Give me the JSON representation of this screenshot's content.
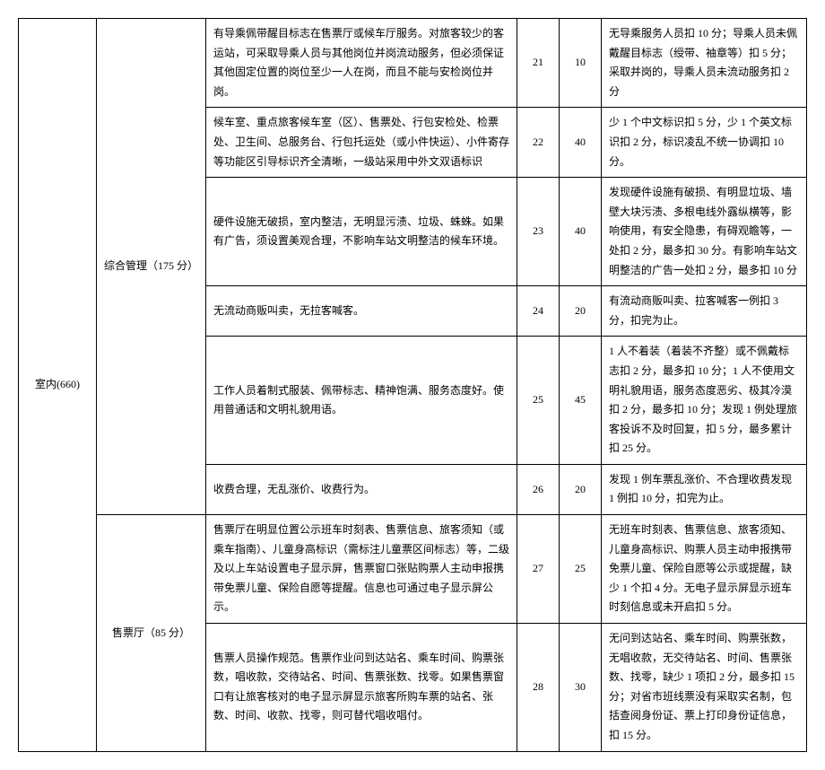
{
  "category1": {
    "label": "室内(660)"
  },
  "category2a": {
    "label": "综合管理（175 分）"
  },
  "category2b": {
    "label": "售票厅（85 分）"
  },
  "rows": [
    {
      "desc": "有导乘佩带醒目标志在售票厅或候车厅服务。对旅客较少的客运站，可采取导乘人员与其他岗位并岗流动服务，但必须保证其他固定位置的岗位至少一人在岗，而且不能与安检岗位并岗。",
      "num": "21",
      "pts": "10",
      "ded": "无导乘服务人员扣 10 分；导乘人员未佩戴醒目标志（绶带、袖章等）扣 5 分；采取并岗的，导乘人员未流动服务扣 2 分"
    },
    {
      "desc": "候车室、重点旅客候车室（区）、售票处、行包安检处、检票处、卫生间、总服务台、行包托运处（或小件快运）、小件寄存等功能区引导标识齐全清晰，一级站采用中外文双语标识",
      "num": "22",
      "pts": "40",
      "ded": "少 1 个中文标识扣 5 分，少 1 个英文标识扣 2 分，标识凌乱不统一协调扣 10 分。"
    },
    {
      "desc": "硬件设施无破损，室内整洁，无明显污渍、垃圾、蛛蛛。如果有广告，须设置美观合理，不影响车站文明整洁的候车环境。",
      "num": "23",
      "pts": "40",
      "ded": "发现硬件设施有破损、有明显垃圾、墙壁大块污渍、多根电线外露纵横等，影响使用，有安全隐患，有碍观瞻等，一处扣 2 分，最多扣 30 分。有影响车站文明整洁的广告一处扣 2 分，最多扣 10 分"
    },
    {
      "desc": "无流动商贩叫卖，无拉客喊客。",
      "num": "24",
      "pts": "20",
      "ded": "有流动商贩叫卖、拉客喊客一例扣 3 分，扣完为止。"
    },
    {
      "desc": "工作人员着制式服装、佩带标志、精神饱满、服务态度好。使用普通话和文明礼貌用语。",
      "num": "25",
      "pts": "45",
      "ded": "1 人不着装（着装不齐整）或不佩戴标志扣 2 分，最多扣 10 分；1 人不使用文明礼貌用语，服务态度恶劣、极其冷漠扣 2 分，最多扣 10 分；发现 1 例处理旅客投诉不及时回复，扣 5 分，最多累计扣 25 分。"
    },
    {
      "desc": "收费合理，无乱涨价、收费行为。",
      "num": "26",
      "pts": "20",
      "ded": "发现 1 例车票乱涨价、不合理收费发现 1 例扣 10 分，扣完为止。"
    },
    {
      "desc": "售票厅在明显位置公示班车时刻表、售票信息、旅客须知（或乘车指南）、儿童身高标识（需标注儿童票区间标志）等，二级及以上车站设置电子显示屏，售票窗口张贴购票人主动申报携带免票儿童、保险自愿等提醒。信息也可通过电子显示屏公示。",
      "num": "27",
      "pts": "25",
      "ded": "无班车时刻表、售票信息、旅客须知、儿童身高标识、购票人员主动申报携带免票儿童、保险自愿等公示或提醒，缺少 1 个扣 4 分。无电子显示屏显示班车时刻信息或未开启扣 5 分。"
    },
    {
      "desc": "售票人员操作规范。售票作业问到达站名、乘车时间、购票张数，唱收款，交待站名、时间、售票张数、找零。如果售票窗口有让旅客核对的电子显示屏显示旅客所购车票的站名、张数、时间、收款、找零，则可替代唱收唱付。",
      "num": "28",
      "pts": "30",
      "ded": "无问到达站名、乘车时间、购票张数，无唱收款，无交待站名、时间、售票张数、找零，缺少 1 项扣 2 分，最多扣 15 分；对省市班线票没有采取实名制，包括查阅身份证、票上打印身份证信息，扣 15 分。"
    }
  ]
}
